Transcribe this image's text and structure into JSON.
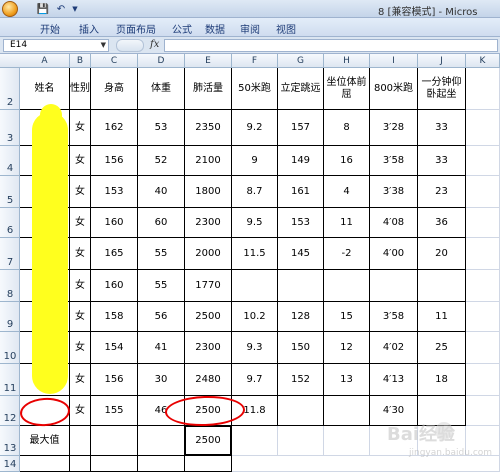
{
  "window": {
    "title": "8 [兼容模式] - Micros"
  },
  "ribbon": {
    "tabs": [
      "开始",
      "插入",
      "页面布局",
      "公式",
      "数据",
      "审阅",
      "视图"
    ]
  },
  "formula_bar": {
    "name_box": "E14",
    "fx": "fx",
    "content": ""
  },
  "columns": [
    "A",
    "B",
    "C",
    "D",
    "E",
    "F",
    "G",
    "H",
    "I",
    "J",
    "K"
  ],
  "rows": [
    "2",
    "3",
    "4",
    "5",
    "6",
    "7",
    "8",
    "9",
    "10",
    "11",
    "12",
    "13",
    "14"
  ],
  "table": {
    "headers": [
      "姓名",
      "性别",
      "身高",
      "体重",
      "肺活量",
      "50米跑",
      "立定跳远",
      "坐位体前屈",
      "800米跑",
      "一分钟仰卧起坐"
    ],
    "rows": [
      [
        "",
        "女",
        "162",
        "53",
        "2350",
        "9.2",
        "157",
        "8",
        "3′28",
        "33"
      ],
      [
        "",
        "女",
        "156",
        "52",
        "2100",
        "9",
        "149",
        "16",
        "3′58",
        "33"
      ],
      [
        "",
        "女",
        "153",
        "40",
        "1800",
        "8.7",
        "161",
        "4",
        "3′38",
        "23"
      ],
      [
        "",
        "女",
        "160",
        "60",
        "2300",
        "9.5",
        "153",
        "11",
        "4′08",
        "36"
      ],
      [
        "",
        "女",
        "165",
        "55",
        "2000",
        "11.5",
        "145",
        "-2",
        "4′00",
        "20"
      ],
      [
        "",
        "女",
        "160",
        "55",
        "1770",
        "",
        "",
        "",
        "",
        ""
      ],
      [
        "",
        "女",
        "158",
        "56",
        "2500",
        "10.2",
        "128",
        "15",
        "3′58",
        "11"
      ],
      [
        "",
        "女",
        "154",
        "41",
        "2300",
        "9.3",
        "150",
        "12",
        "4′02",
        "25"
      ],
      [
        "",
        "女",
        "156",
        "30",
        "2480",
        "9.7",
        "152",
        "13",
        "4′13",
        "18"
      ],
      [
        "",
        "女",
        "155",
        "46",
        "2500",
        "11.8",
        "",
        "",
        "4′30",
        ""
      ]
    ],
    "summary_row": {
      "label": "最大值",
      "value": "2500"
    }
  },
  "watermark": {
    "logo": "Bai经验",
    "sub": "jingyan.baidu.com"
  },
  "colors": {
    "highlight_yellow": "#ffff1e",
    "annotation_red": "#e80000"
  }
}
